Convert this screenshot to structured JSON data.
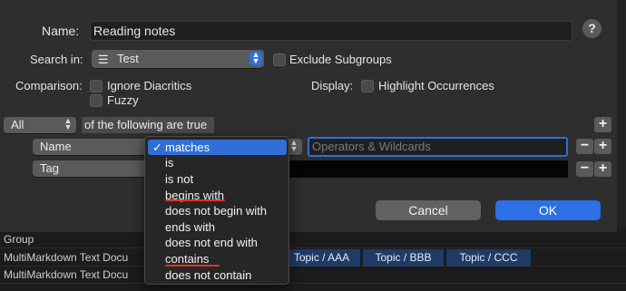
{
  "dialog": {
    "name_label": "Name:",
    "name_value": "Reading notes",
    "help_label": "?",
    "search_in_label": "Search in:",
    "search_in_value": "Test",
    "exclude_subgroups_label": "Exclude Subgroups",
    "comparison_label": "Comparison:",
    "ignore_diacritics_label": "Ignore Diacritics",
    "fuzzy_label": "Fuzzy",
    "display_label": "Display:",
    "highlight_label": "Highlight Occurrences",
    "match_scope_value": "All",
    "match_scope_suffix": "of the following are true",
    "add_label": "+",
    "remove_label": "−",
    "rule1_field": "Name",
    "rule1_placeholder": "Operators & Wildcards",
    "rule2_field": "Tag",
    "cancel_label": "Cancel",
    "ok_label": "OK"
  },
  "operator_menu": {
    "items": [
      "matches",
      "is",
      "is not",
      "begins with",
      "does not begin with",
      "ends with",
      "does not end with",
      "contains",
      "does not contain"
    ],
    "selected": "matches",
    "check_glyph": "✓"
  },
  "background": {
    "row_group": "Group",
    "row_doc": "MultiMarkdown Text Docu",
    "tags": [
      "Topic / AAA",
      "Topic / BBB",
      "Topic / CCC"
    ]
  },
  "colors": {
    "accent": "#2f6fd6",
    "annotation_underline": "#e0312b"
  }
}
